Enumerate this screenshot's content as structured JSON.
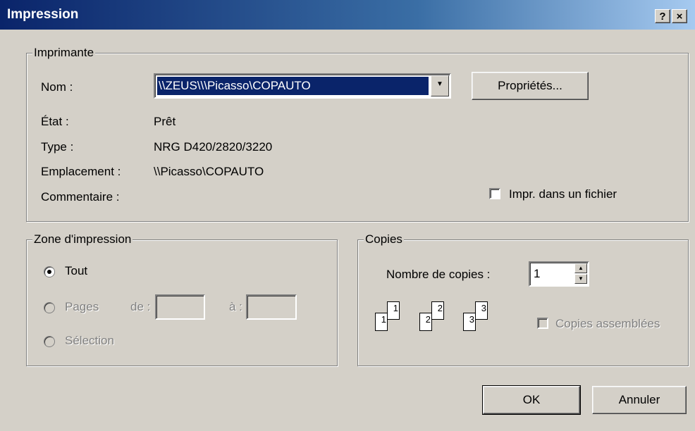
{
  "window": {
    "title": "Impression",
    "help_label": "?",
    "close_label": "×"
  },
  "printer": {
    "group_label": "Imprimante",
    "name_label": "Nom :",
    "name_value": "\\\\ZEUS\\\\\\Picasso\\COPAUTO",
    "properties_label": "Propriétés...",
    "status_label": "État :",
    "status_value": "Prêt",
    "type_label": "Type :",
    "type_value": "NRG D420/2820/3220",
    "location_label": "Emplacement :",
    "location_value": "\\\\Picasso\\COPAUTO",
    "comment_label": "Commentaire :",
    "print_to_file_label": "Impr. dans un fichier",
    "print_to_file_checked": false
  },
  "range": {
    "group_label": "Zone d'impression",
    "all_label": "Tout",
    "pages_label": "Pages",
    "from_label": "de :",
    "to_label": "à :",
    "selection_label": "Sélection",
    "selected": "all"
  },
  "copies": {
    "group_label": "Copies",
    "count_label": "Nombre de copies :",
    "count_value": "1",
    "collate_label": "Copies assemblées",
    "collate_checked": false,
    "page_numbers": [
      "1",
      "1",
      "2",
      "2",
      "3",
      "3"
    ]
  },
  "actions": {
    "ok_label": "OK",
    "cancel_label": "Annuler"
  },
  "colors": {
    "face": "#d4d0c8",
    "title_start": "#0a246a",
    "title_end": "#a6caf0",
    "selection": "#0a246a"
  }
}
